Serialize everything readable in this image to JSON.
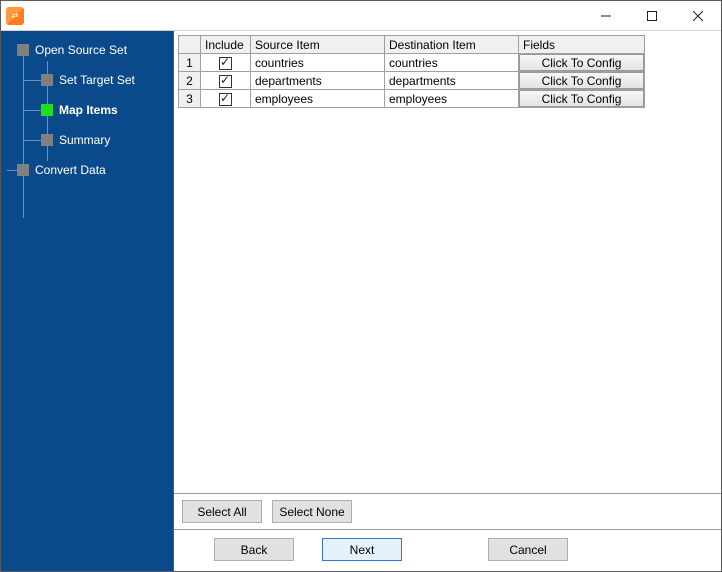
{
  "window": {
    "title": ""
  },
  "sidebar": {
    "items": [
      {
        "label": "Open Source Set",
        "level": 0,
        "active": false
      },
      {
        "label": "Set Target Set",
        "level": 1,
        "active": false
      },
      {
        "label": "Map Items",
        "level": 1,
        "active": true
      },
      {
        "label": "Summary",
        "level": 1,
        "active": false
      },
      {
        "label": "Convert Data",
        "level": 0,
        "active": false
      }
    ]
  },
  "table": {
    "headers": {
      "include": "Include",
      "source": "Source Item",
      "dest": "Destination Item",
      "fields": "Fields"
    },
    "config_button_label": "Click To Config",
    "rows": [
      {
        "n": "1",
        "include": true,
        "source": "countries",
        "dest": "countries"
      },
      {
        "n": "2",
        "include": true,
        "source": "departments",
        "dest": "departments"
      },
      {
        "n": "3",
        "include": true,
        "source": "employees",
        "dest": "employees"
      }
    ]
  },
  "buttons": {
    "select_all": "Select All",
    "select_none": "Select None",
    "back": "Back",
    "next": "Next",
    "cancel": "Cancel"
  }
}
